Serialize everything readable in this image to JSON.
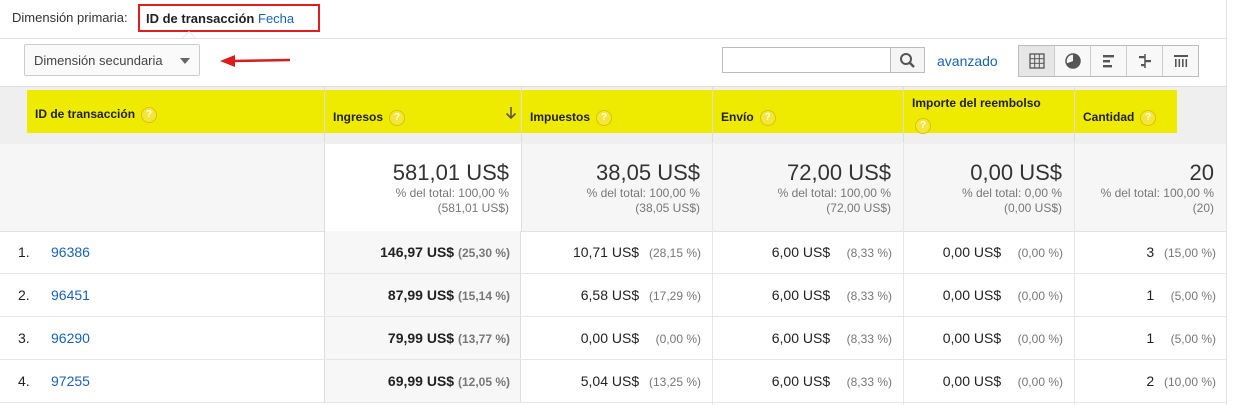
{
  "primary": {
    "label": "Dimensión primaria:",
    "active": "ID de transacción",
    "other": "Fecha"
  },
  "secondary": {
    "label": "Dimensión secundaria"
  },
  "search": {
    "value": "",
    "advanced": "avanzado"
  },
  "columns": [
    {
      "label": "ID de transacción",
      "help": "?"
    },
    {
      "label": "Ingresos",
      "help": "?"
    },
    {
      "label": "Impuestos",
      "help": "?"
    },
    {
      "label": "Envío",
      "help": "?"
    },
    {
      "label": "Importe del reembolso",
      "help": "?"
    },
    {
      "label": "Cantidad",
      "help": "?"
    }
  ],
  "totals": [
    {
      "value": "581,01 US$",
      "pct": "% del total: 100,00 %",
      "sub": "(581,01 US$)"
    },
    {
      "value": "38,05 US$",
      "pct": "% del total: 100,00 %",
      "sub": "(38,05 US$)"
    },
    {
      "value": "72,00 US$",
      "pct": "% del total: 100,00 %",
      "sub": "(72,00 US$)"
    },
    {
      "value": "0,00 US$",
      "pct": "% del total: 0,00 %",
      "sub": "(0,00 US$)"
    },
    {
      "value": "20",
      "pct": "% del total: 100,00 %",
      "sub": "(20)"
    }
  ],
  "rows": [
    {
      "idx": "1.",
      "id": "96386",
      "ingresos": "146,97 US$",
      "ingresos_pct": "(25,30 %)",
      "impuestos": "10,71 US$",
      "impuestos_pct": "(28,15 %)",
      "envio": "6,00 US$",
      "envio_pct": "(8,33 %)",
      "reembolso": "0,00 US$",
      "reembolso_pct": "(0,00 %)",
      "cantidad": "3",
      "cantidad_pct": "(15,00 %)"
    },
    {
      "idx": "2.",
      "id": "96451",
      "ingresos": "87,99 US$",
      "ingresos_pct": "(15,14 %)",
      "impuestos": "6,58 US$",
      "impuestos_pct": "(17,29 %)",
      "envio": "6,00 US$",
      "envio_pct": "(8,33 %)",
      "reembolso": "0,00 US$",
      "reembolso_pct": "(0,00 %)",
      "cantidad": "1",
      "cantidad_pct": "(5,00 %)"
    },
    {
      "idx": "3.",
      "id": "96290",
      "ingresos": "79,99 US$",
      "ingresos_pct": "(13,77 %)",
      "impuestos": "0,00 US$",
      "impuestos_pct": "(0,00 %)",
      "envio": "6,00 US$",
      "envio_pct": "(8,33 %)",
      "reembolso": "0,00 US$",
      "reembolso_pct": "(0,00 %)",
      "cantidad": "1",
      "cantidad_pct": "(5,00 %)"
    },
    {
      "idx": "4.",
      "id": "97255",
      "ingresos": "69,99 US$",
      "ingresos_pct": "(12,05 %)",
      "impuestos": "5,04 US$",
      "impuestos_pct": "(13,25 %)",
      "envio": "6,00 US$",
      "envio_pct": "(8,33 %)",
      "reembolso": "0,00 US$",
      "reembolso_pct": "(0,00 %)",
      "cantidad": "2",
      "cantidad_pct": "(10,00 %)"
    }
  ],
  "colors": {
    "link": "#1a63b3",
    "highlight": "#eeea00",
    "annotation": "#e01e1e"
  }
}
